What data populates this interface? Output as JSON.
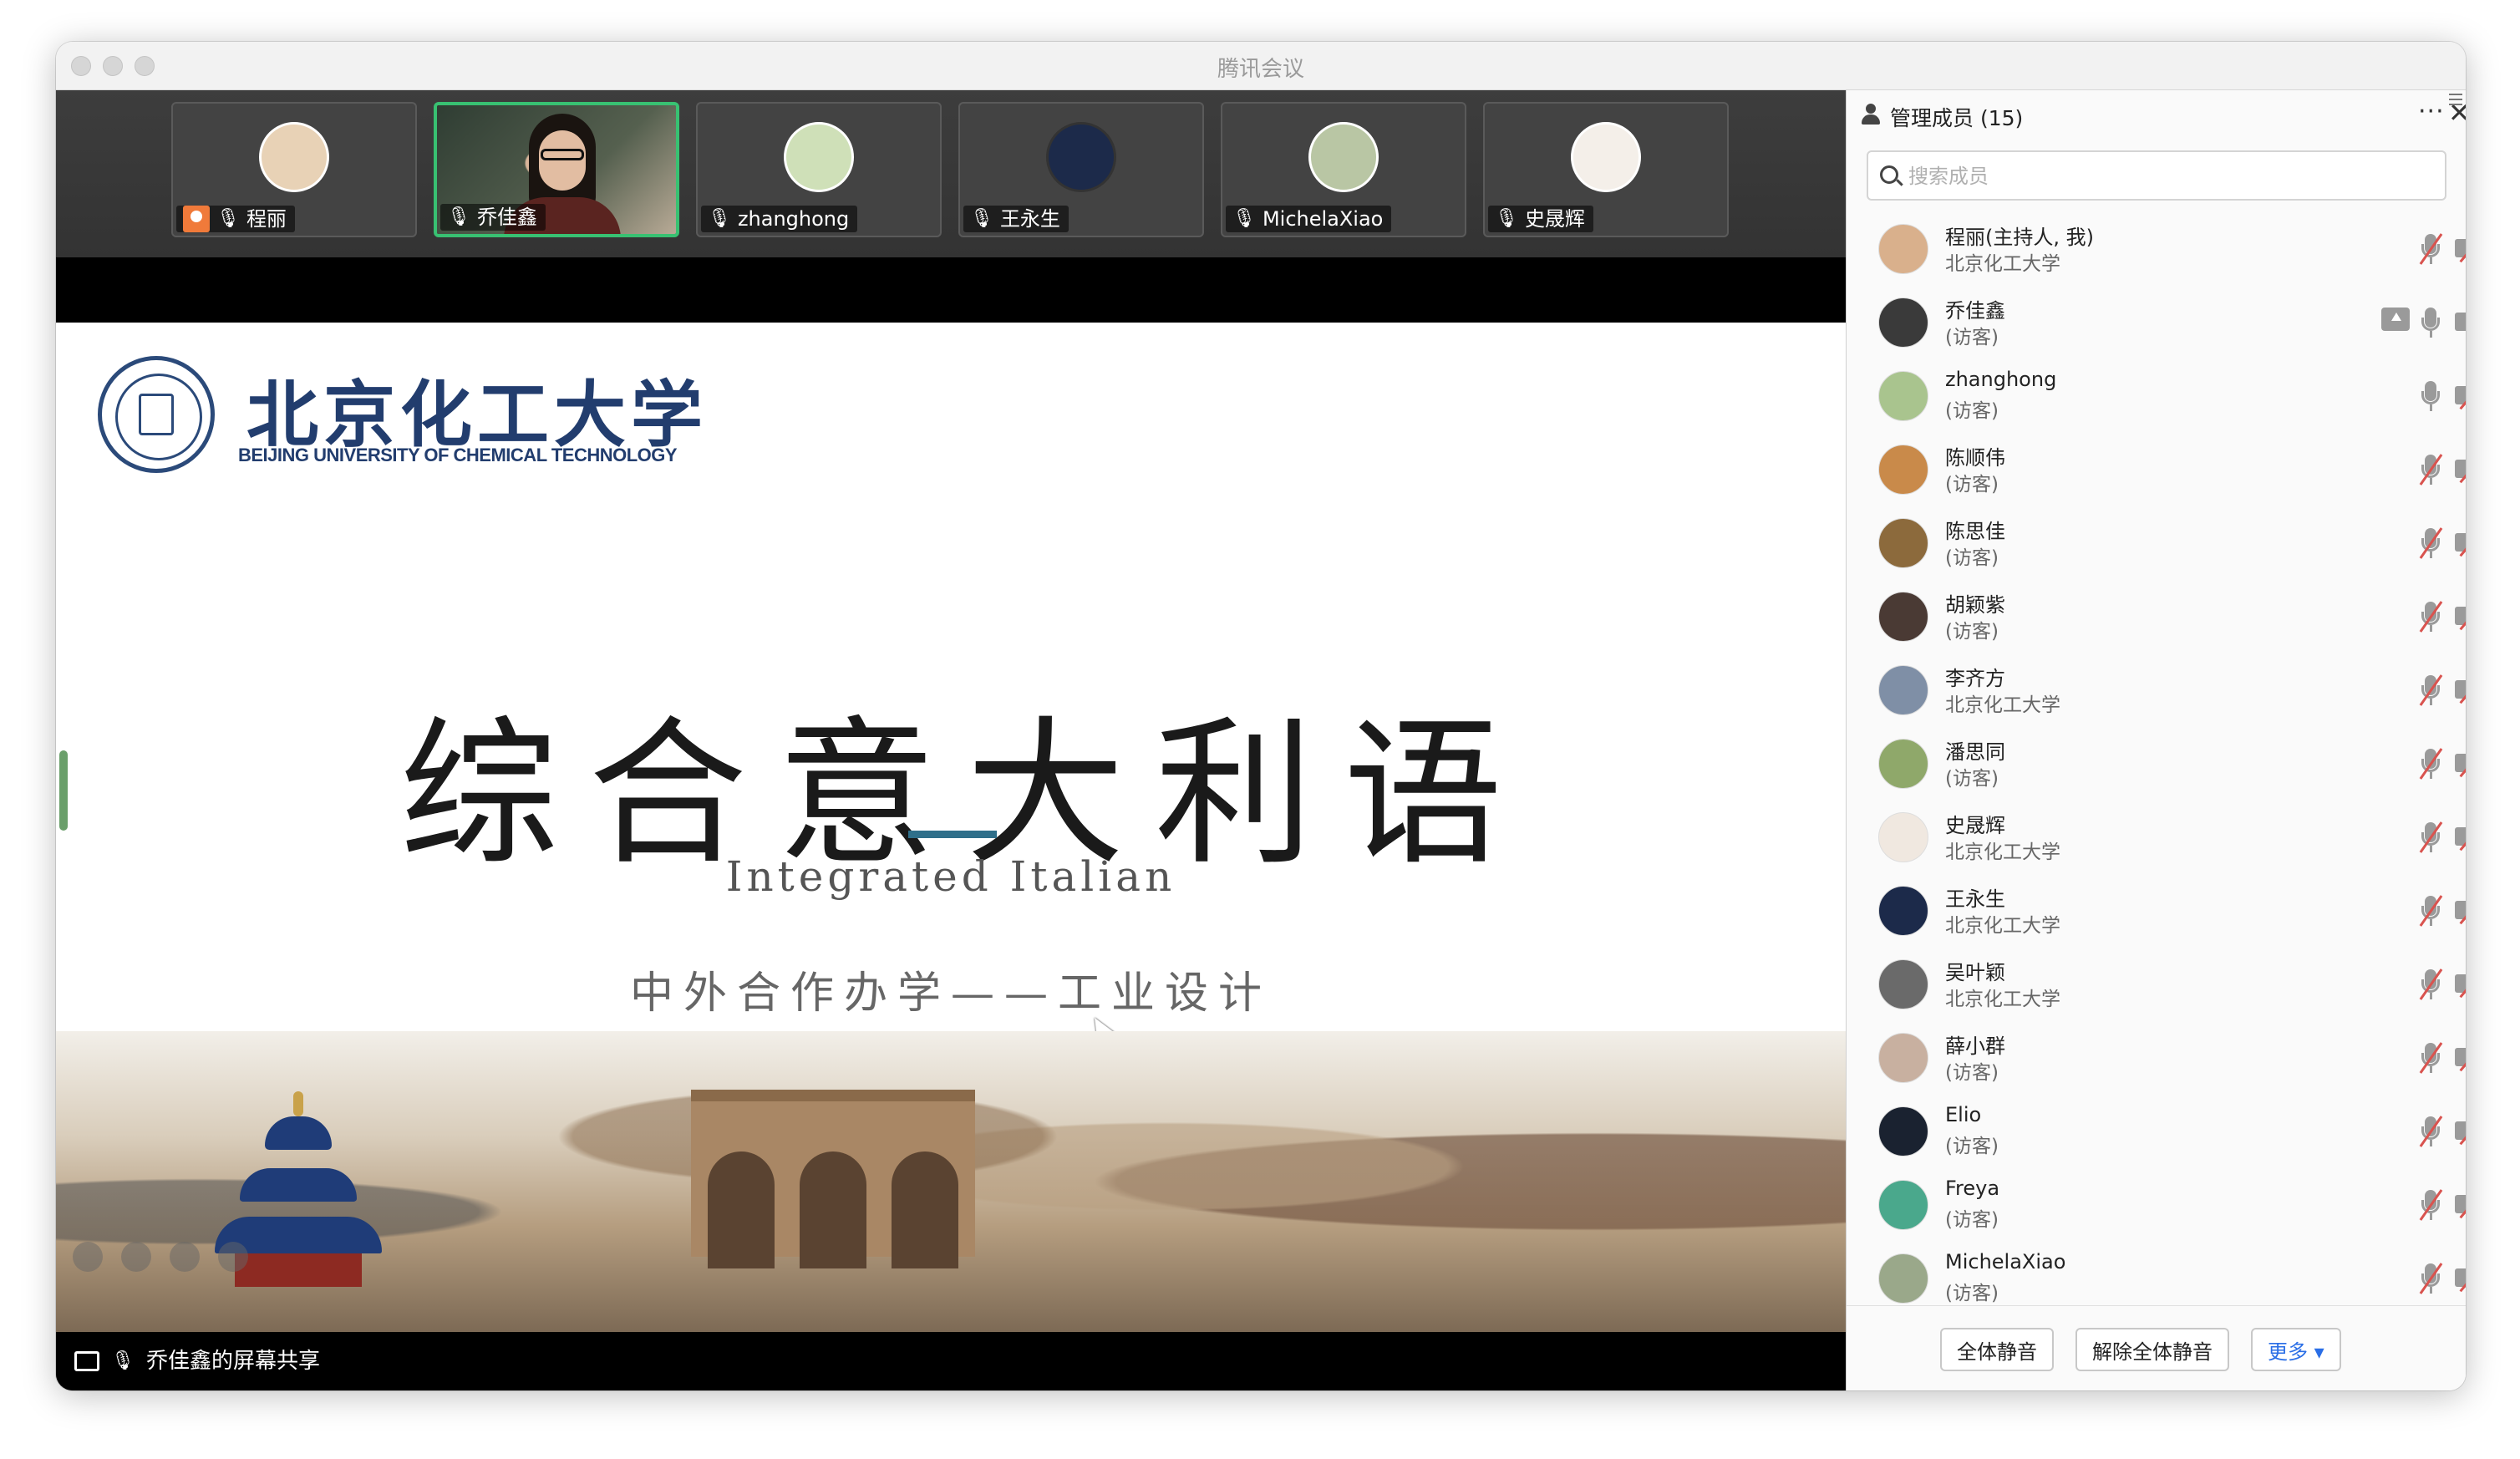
{
  "window": {
    "title": "腾讯会议"
  },
  "video_strip": [
    {
      "name": "程丽",
      "host": true,
      "muted": true
    },
    {
      "name": "乔佳鑫",
      "active": true,
      "muted": false
    },
    {
      "name": "zhanghong",
      "muted": false
    },
    {
      "name": "王永生",
      "muted": true
    },
    {
      "name": "MichelaXiao",
      "muted": true
    },
    {
      "name": "史晟辉",
      "muted": true
    }
  ],
  "slide": {
    "university_cn": "北京化工大学",
    "university_en": "BEIJING UNIVERSITY OF CHEMICAL TECHNOLOGY",
    "title": "综合意大利语",
    "subtitle": "Integrated Italian",
    "subtitle2": "中外合作办学——工业设计"
  },
  "share_bar": {
    "label": "乔佳鑫的屏幕共享"
  },
  "panel": {
    "title": "管理成员 (15)",
    "more_icon": "more-horizontal-icon",
    "close_icon": "close-icon",
    "search_placeholder": "搜索成员",
    "members": [
      {
        "name": "程丽(主持人, 我)",
        "sub": "北京化工大学",
        "avatar_color": "#d9b08c",
        "sharing": false,
        "mic_on": false,
        "cam_on": false
      },
      {
        "name": "乔佳鑫",
        "sub": "(访客)",
        "avatar_color": "#3a3a3a",
        "sharing": true,
        "mic_on": true,
        "cam_on": true
      },
      {
        "name": "zhanghong",
        "sub": "(访客)",
        "avatar_color": "#a9c48e",
        "sharing": false,
        "mic_on": true,
        "cam_on": false
      },
      {
        "name": "陈顺伟",
        "sub": "(访客)",
        "avatar_color": "#c98a4a",
        "sharing": false,
        "mic_on": false,
        "cam_on": false
      },
      {
        "name": "陈思佳",
        "sub": "(访客)",
        "avatar_color": "#8c6a3c",
        "sharing": false,
        "mic_on": false,
        "cam_on": false
      },
      {
        "name": "胡颖紫",
        "sub": "(访客)",
        "avatar_color": "#4a3a34",
        "sharing": false,
        "mic_on": false,
        "cam_on": false
      },
      {
        "name": "李齐方",
        "sub": "北京化工大学",
        "avatar_color": "#7f8fa6",
        "sharing": false,
        "mic_on": false,
        "cam_on": false
      },
      {
        "name": "潘思同",
        "sub": "(访客)",
        "avatar_color": "#8fa86a",
        "sharing": false,
        "mic_on": false,
        "cam_on": false
      },
      {
        "name": "史晟辉",
        "sub": "北京化工大学",
        "avatar_color": "#f0e8e0",
        "sharing": false,
        "mic_on": false,
        "cam_on": false
      },
      {
        "name": "王永生",
        "sub": "北京化工大学",
        "avatar_color": "#1c2a4a",
        "sharing": false,
        "mic_on": false,
        "cam_on": false
      },
      {
        "name": "吴叶颖",
        "sub": "北京化工大学",
        "avatar_color": "#6a6a6a",
        "sharing": false,
        "mic_on": false,
        "cam_on": false
      },
      {
        "name": "薛小群",
        "sub": "(访客)",
        "avatar_color": "#c8b0a0",
        "sharing": false,
        "mic_on": false,
        "cam_on": false
      },
      {
        "name": "Elio",
        "sub": "(访客)",
        "avatar_color": "#1a2230",
        "sharing": false,
        "mic_on": false,
        "cam_on": false
      },
      {
        "name": "Freya",
        "sub": "(访客)",
        "avatar_color": "#4aa88c",
        "sharing": false,
        "mic_on": false,
        "cam_on": false
      },
      {
        "name": "MichelaXiao",
        "sub": "(访客)",
        "avatar_color": "#9aa88a",
        "sharing": false,
        "mic_on": false,
        "cam_on": false
      }
    ],
    "buttons": {
      "mute_all": "全体静音",
      "unmute_all": "解除全体静音",
      "more": "更多 ▾"
    }
  }
}
